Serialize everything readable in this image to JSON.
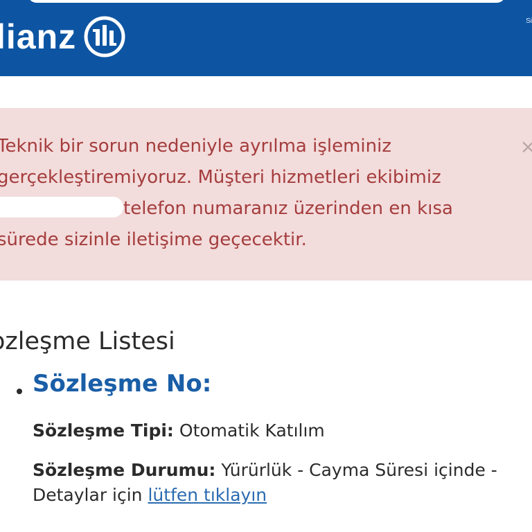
{
  "header": {
    "logo_text": "lianz",
    "logo_mark": "allianz-eagle-logo",
    "corner_text": "Si",
    "colors": {
      "background": "#0d55a3",
      "text": "#ffffff"
    }
  },
  "alert": {
    "line1": "Teknik bir sorun nedeniyle ayrılma işleminiz",
    "line2": "gerçekleştiremiyoruz. Müşteri hizmetleri ekibimiz",
    "line3_after_redaction": "telefon numaranız üzerinden en kısa",
    "line4": "sürede sizinle iletişime geçecektir.",
    "close_symbol": "×",
    "colors": {
      "background": "#f3dcdc",
      "text": "#a53d3d"
    }
  },
  "section": {
    "title": "ozleşme Listesi"
  },
  "contract": {
    "number_label": "Sözleşme No:",
    "type_label": "Sözleşme Tipi:",
    "type_value": "Otomatik Katılım",
    "status_label": "Sözleşme Durumu:",
    "status_value": "Yürürlük - Cayma Süresi içinde -",
    "details_text": "Detaylar için",
    "details_link": "lütfen tıklayın",
    "colors": {
      "number": "#1a5ea7",
      "link": "#2a6bb0"
    }
  }
}
